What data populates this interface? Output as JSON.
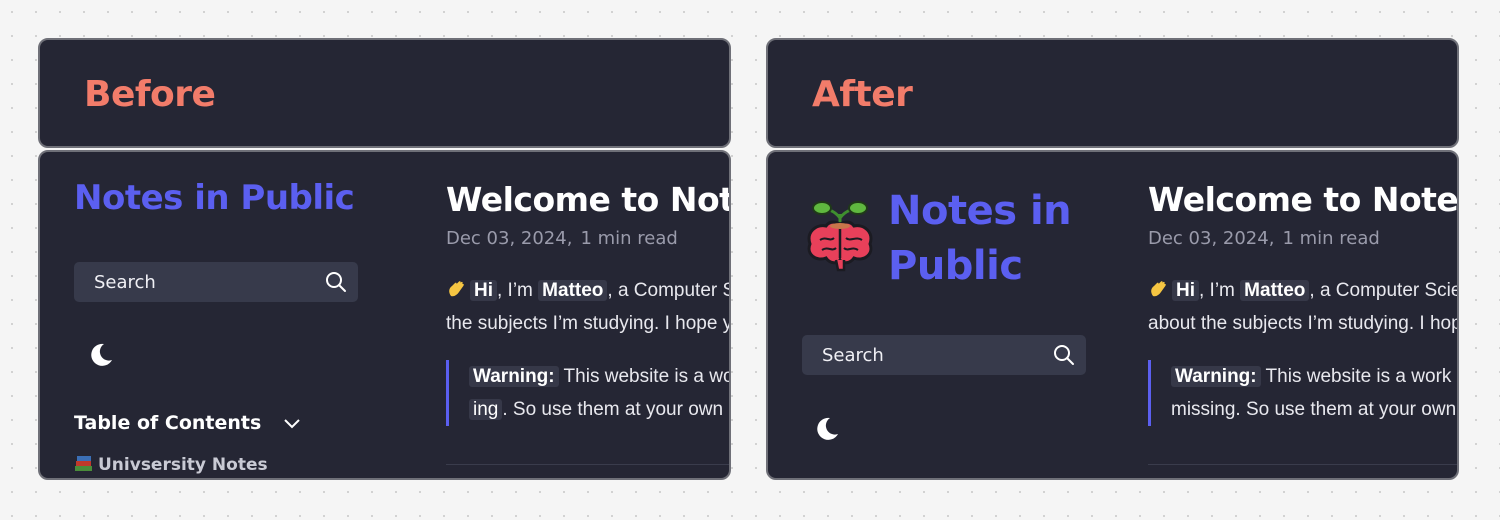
{
  "panels": [
    {
      "label": "Before",
      "site_title_line1": "Notes in Public",
      "site_title_line2": "",
      "search_label": "Search",
      "toc_heading": "Table of Contents",
      "toc_item": "Univsersity Notes",
      "article": {
        "title": "Welcome to Notes in Public",
        "date": "Dec 03, 2024,",
        "read_time": "1 min read",
        "intro_prefix": ", I’m ",
        "hi": "Hi",
        "name": "Matteo",
        "intro_suffix": ", a Computer Science student",
        "line2": "the subjects I’m studying. I hope you enjoy",
        "warning_label": "Warning:",
        "warning_text": " This website is a work in progress",
        "warning_line2_chip": "ing",
        "warning_line2": ". So use them at your own risk."
      }
    },
    {
      "label": "After",
      "site_title_line1": "Notes in",
      "site_title_line2": "Public",
      "search_label": "Search",
      "article": {
        "title": "Welcome to Notes in Public",
        "date": "Dec 03, 2024,",
        "read_time": "1 min read",
        "intro_prefix": ", I’m ",
        "hi": "Hi",
        "name": "Matteo",
        "intro_suffix": ", a Computer Science student",
        "line2": "about the subjects I’m studying. I hope you",
        "warning_label": "Warning:",
        "warning_text": " This website is a work in progress",
        "warning_line2": "missing. So use them at your own risk."
      }
    }
  ],
  "colors": {
    "background": "#f5f5f5",
    "card": "#252634",
    "label": "#f27c6a",
    "accent": "#5b5ff0",
    "search_box": "#373a4b"
  },
  "icons": [
    "search-icon",
    "moon-icon",
    "chevron-down-icon",
    "books-icon",
    "waving-hand-icon",
    "brain-sprout-logo-icon"
  ]
}
